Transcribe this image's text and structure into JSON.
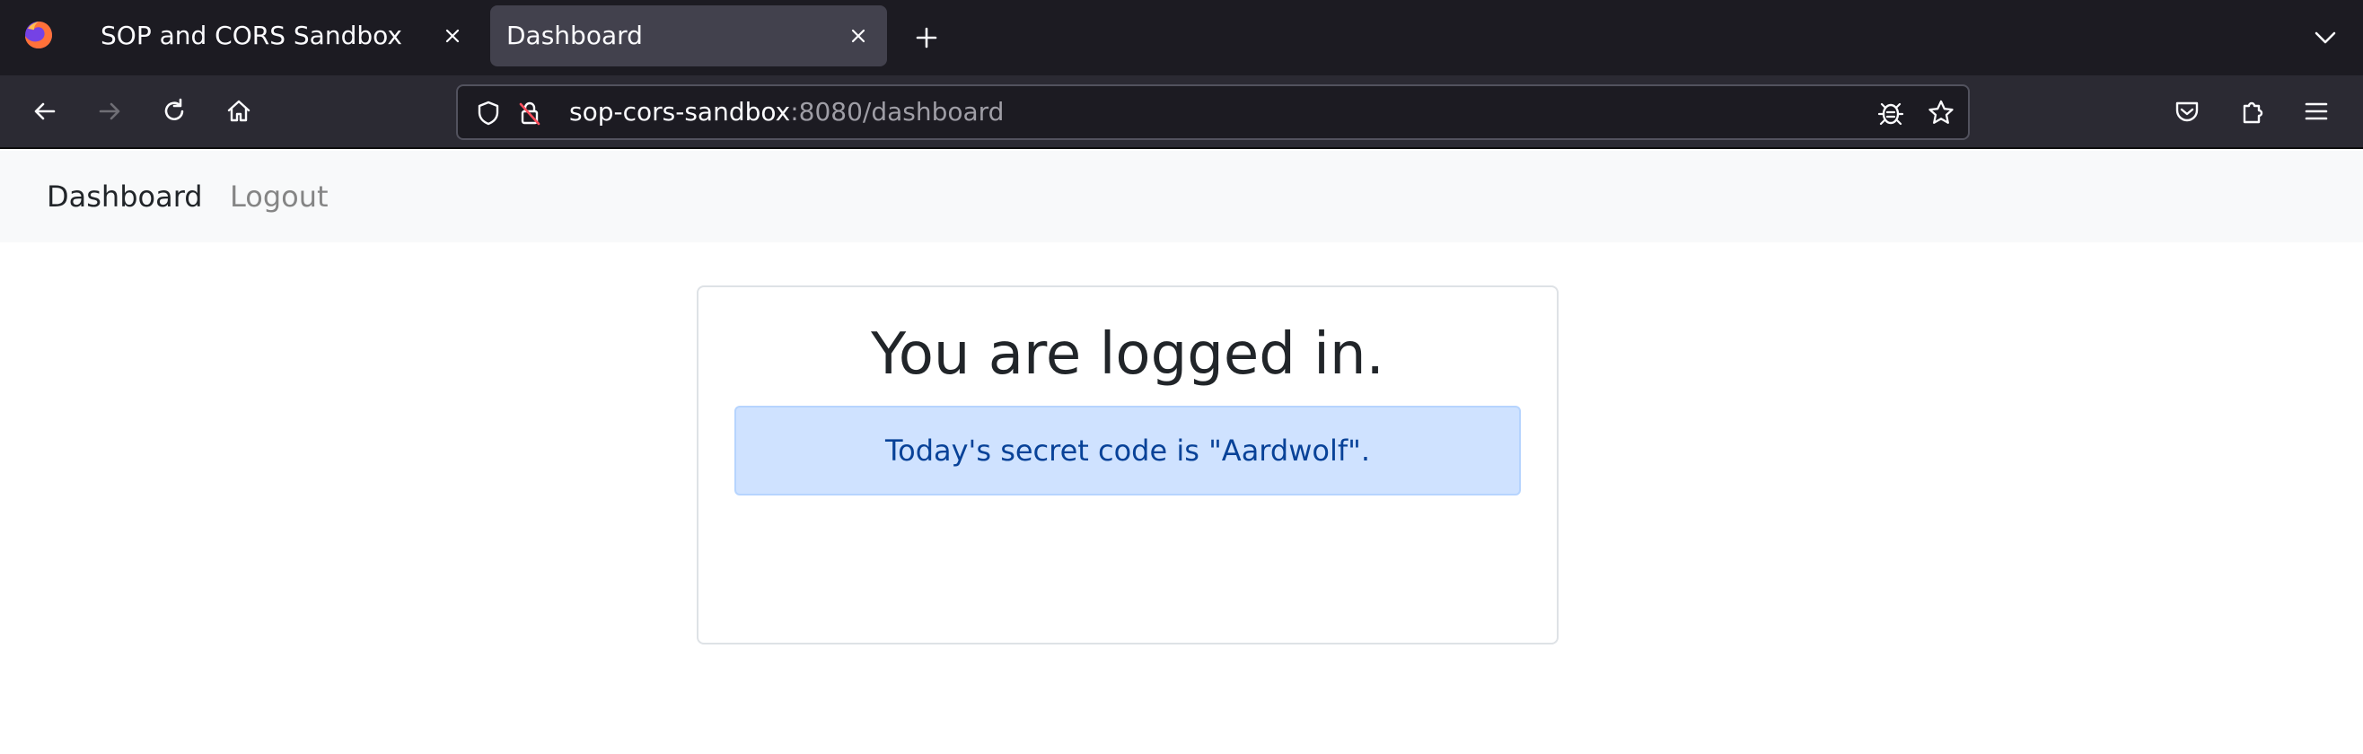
{
  "browser": {
    "tabs": [
      {
        "title": "SOP and CORS Sandbox",
        "active": false
      },
      {
        "title": "Dashboard",
        "active": true
      }
    ],
    "url": {
      "host": "sop-cors-sandbox",
      "rest": ":8080/dashboard"
    },
    "icons": {
      "logo": "firefox-logo-icon",
      "close": "close-icon",
      "new_tab": "plus-icon",
      "tab_list": "chevron-down-icon",
      "back": "back-arrow-icon",
      "forward": "forward-arrow-icon",
      "reload": "reload-icon",
      "home": "home-icon",
      "tracking": "shield-icon",
      "insecure": "insecure-lock-icon",
      "bug": "bug-icon",
      "bookmark": "star-icon",
      "pocket": "pocket-icon",
      "extensions": "extensions-icon",
      "menu": "hamburger-menu-icon"
    }
  },
  "page": {
    "nav": {
      "brand": "Dashboard",
      "links": [
        "Logout"
      ]
    },
    "heading": "You are logged in.",
    "alert": "Today's secret code is \"Aardwolf\"."
  },
  "colors": {
    "tabstrip_bg": "#1c1b22",
    "active_tab_bg": "#42414d",
    "navbar_bg": "#2b2a33",
    "page_nav_bg": "#f8f9fa",
    "alert_bg": "#cfe2ff",
    "alert_text": "#084298"
  }
}
